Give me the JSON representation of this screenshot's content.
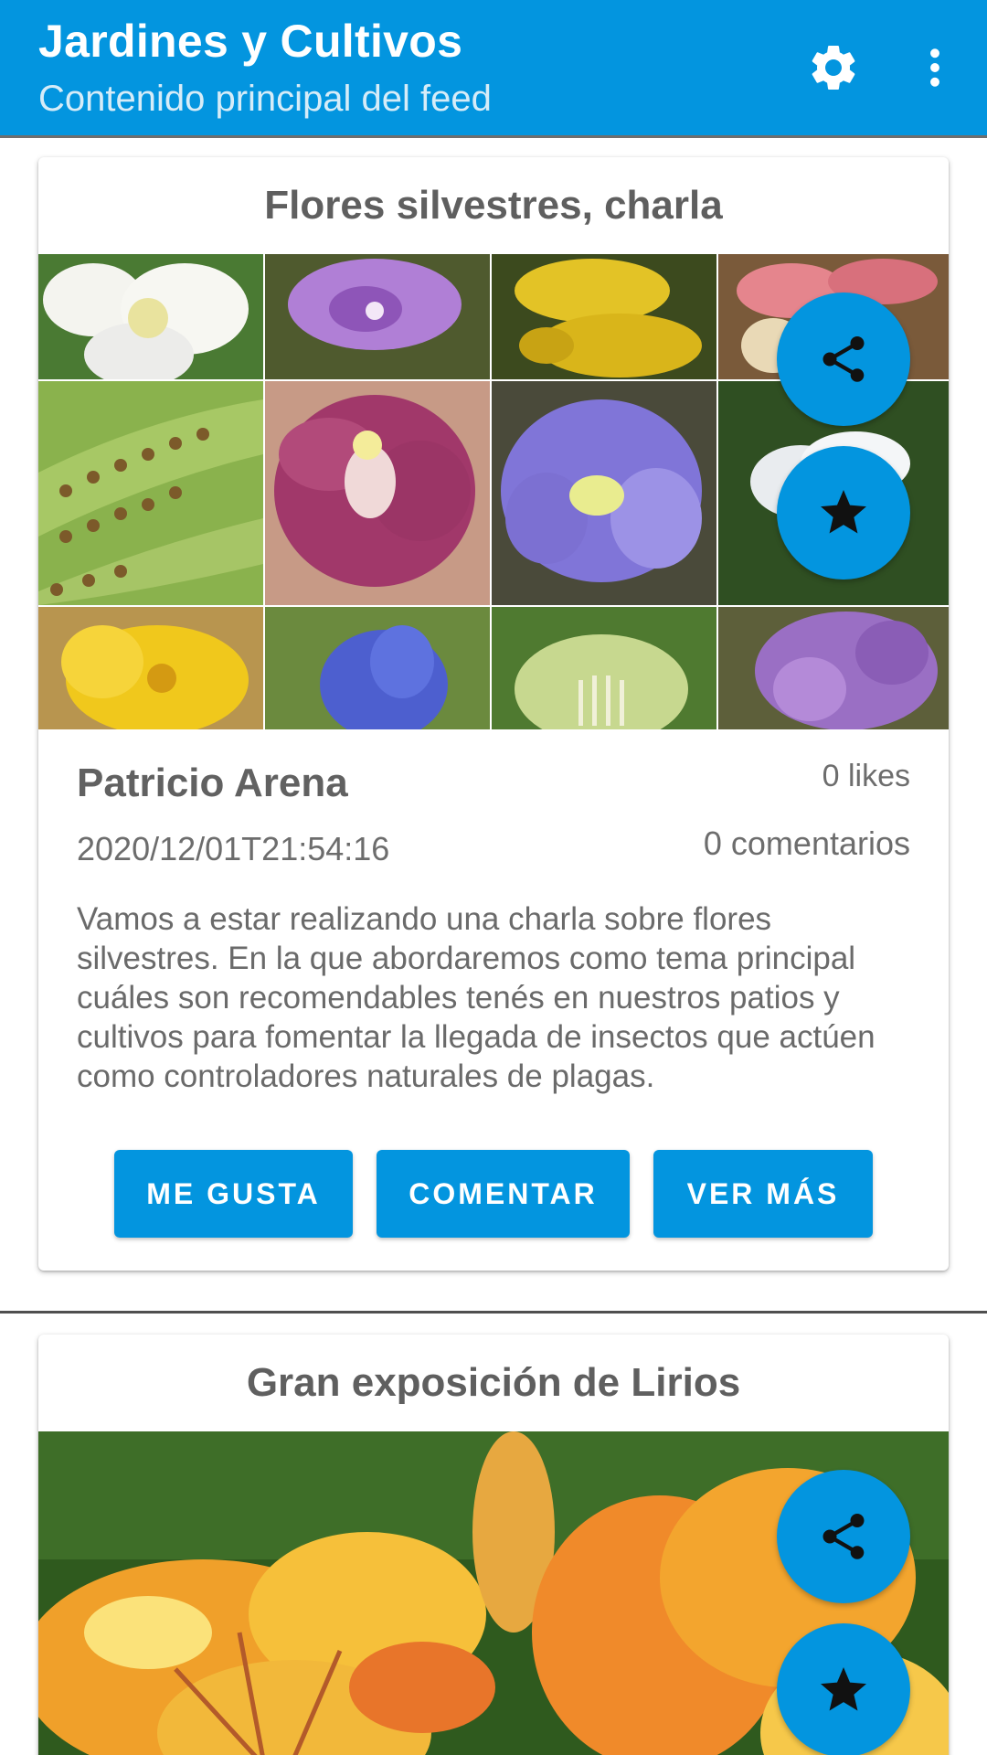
{
  "appbar": {
    "title": "Jardines y Cultivos",
    "subtitle": "Contenido principal del feed",
    "icons": [
      "gear-icon",
      "more-vert-icon"
    ]
  },
  "colors": {
    "primary": "#0395df",
    "white": "#ffffff",
    "text": "#6a6a6a"
  },
  "posts": [
    {
      "title": "Flores silvestres, charla",
      "author": "Patricio Arena",
      "date": "2020/12/01T21:54:16",
      "likes": "0 likes",
      "comments": "0 comentarios",
      "description": "Vamos a estar realizando una charla sobre flores silvestres. En la que abordaremos como tema principal cuáles son recomendables tenés en nuestros patios y cultivos para fomentar la llegada de insectos que actúen como controladores naturales de plagas.",
      "buttons": {
        "like": "ME GUSTA",
        "comment": "COMENTAR",
        "more": "VER MÁS"
      },
      "image": "wildflowers-mosaic"
    },
    {
      "title": "Gran exposición de Lirios",
      "image": "orange-lilies-photo"
    }
  ]
}
